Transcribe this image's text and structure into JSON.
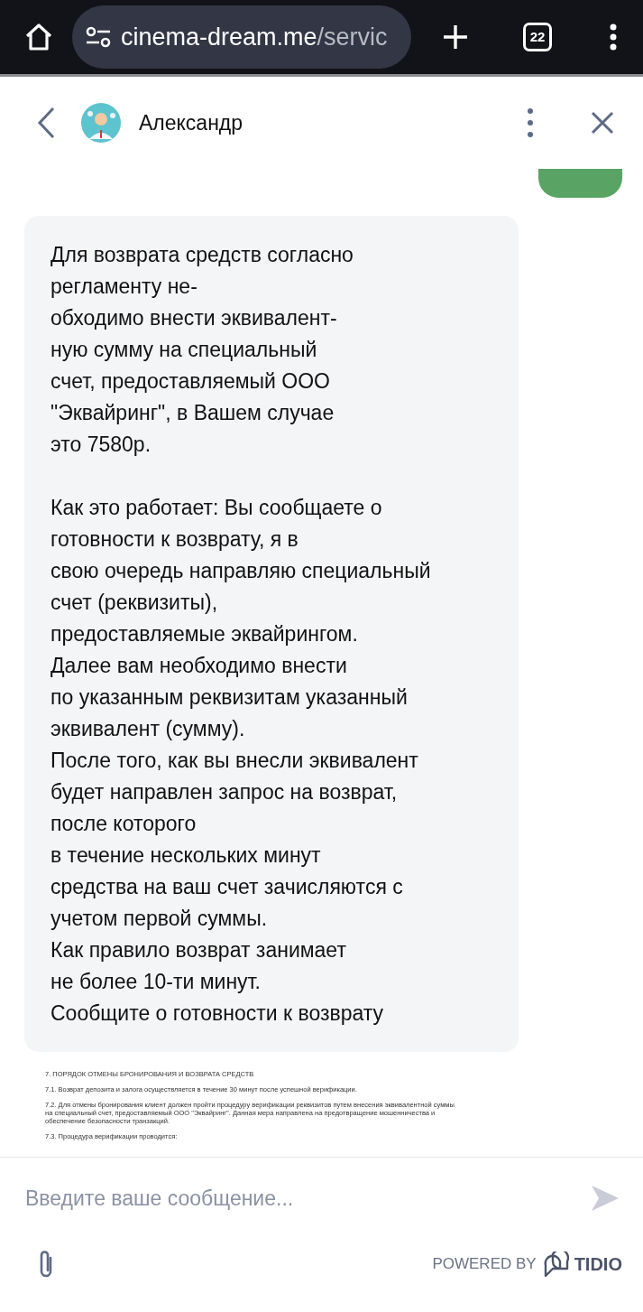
{
  "browser": {
    "url_domain": "cinema-dream.me",
    "url_path": "/servic",
    "tab_count": "22"
  },
  "chat_header": {
    "agent_name": "Александр"
  },
  "messages": [
    {
      "kind": "outgoing"
    },
    {
      "kind": "incoming",
      "paragraphs": [
        [
          "Для возврата средств согласно",
          "регламенту не-",
          "обходимо внести эквивалент-",
          "ную сумму на специальный",
          "счет, предоставляемый ООО",
          "\"Эквайринг\", в Вашем случае",
          "это 7580р."
        ],
        [
          "Как это работает: Вы сообщаете о",
          "готовности к возврату, я в",
          "свою очередь направляю специальный",
          "счет (реквизиты),",
          "предоставляемые эквайрингом.",
          "Далее вам необходимо внести",
          "по указанным реквизитам указанный",
          "эквивалент (сумму).",
          "После того, как вы внесли эквивалент",
          "будет направлен запрос на возврат,",
          "после которого",
          "в течение нескольких минут",
          "средства на ваш счет зачисляются с",
          "учетом первой суммы.",
          "Как правило возврат занимает",
          "не более 10-ти минут.",
          "Сообщите о готовности к возврату"
        ]
      ]
    },
    {
      "kind": "document",
      "heading": "7. ПОРЯДОК ОТМЕНЫ БРОНИРОВАНИЯ И ВОЗВРАТА СРЕДСТВ",
      "paragraphs": [
        "7.1. Возврат депозита и залога осуществляется в течение 30 минут после успешной верификации.",
        "7.2. Для отмены бронирования клиент должен пройти процедуру верификации реквизитов путем внесения эквивалентной суммы на специальный счет, предоставляемый ООО \"Эквайринг\". Данная мера направлена на предотвращение мошенничества и обеспечение безопасности транзакций.",
        "7.3. Процедура верификации проводится:"
      ]
    }
  ],
  "composer": {
    "placeholder": "Введите ваше сообщение..."
  },
  "footer": {
    "powered_by": "POWERED BY",
    "brand": "TIDIO"
  }
}
